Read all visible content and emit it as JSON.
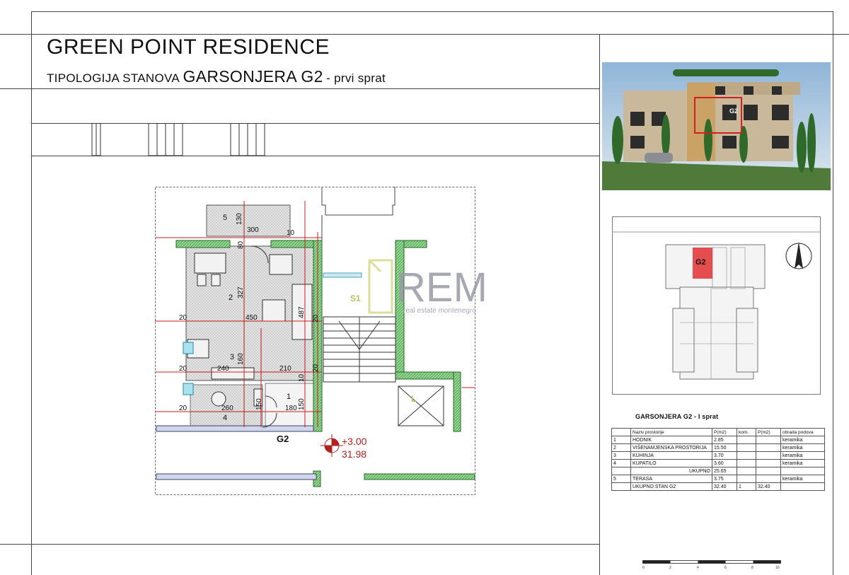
{
  "sheet": {
    "title": "GREEN POINT RESIDENCE",
    "subtitle_prefix": "TIPOLOGIJA STANOVA",
    "subtitle_unit": "GARSONJERA G2",
    "subtitle_suffix": "- prvi sprat"
  },
  "plan": {
    "unit_label": "G2",
    "elevation": "+3.00",
    "level_value": "31.98",
    "stair_label": "S1",
    "lift_label": "L",
    "rooms": [
      "5",
      "2",
      "3",
      "1",
      "4"
    ],
    "dimensions": [
      "300",
      "130",
      "10",
      "327",
      "450",
      "487",
      "20",
      "160",
      "240",
      "210",
      "10",
      "20",
      "260",
      "150",
      "180",
      "150",
      "20",
      "80",
      "20",
      "20"
    ]
  },
  "watermark": {
    "brand": "REM",
    "tagline": "real estate montenegro"
  },
  "photo": {
    "unit_tag": "G2"
  },
  "keyplan": {
    "unit_tag": "G2"
  },
  "table": {
    "title": "GARSONJERA G2 - I sprat",
    "headers": [
      "",
      "Naziv prostorije",
      "P(m2)",
      "kom.",
      "P(m2)",
      "obrada podova"
    ],
    "rows": [
      {
        "no": "1",
        "name": "HODNIK",
        "area": "2.85",
        "kom": "",
        "p": "",
        "floor": "keramika"
      },
      {
        "no": "2",
        "name": "VIŠENAMJENSKA PROSTORIJA",
        "area": "15.50",
        "kom": "",
        "p": "",
        "floor": "keramika"
      },
      {
        "no": "3",
        "name": "KUHINJA",
        "area": "3.70",
        "kom": "",
        "p": "",
        "floor": "keramika"
      },
      {
        "no": "4",
        "name": "KUPATILO",
        "area": "3.60",
        "kom": "",
        "p": "",
        "floor": "keramika"
      }
    ],
    "subtotal_label": "UKUPNO",
    "subtotal_value": "25.65",
    "terrace": {
      "no": "5",
      "name": "TERASA",
      "area": "3.75",
      "floor": "keramika"
    },
    "total": {
      "label": "UKUPNO STAN G2",
      "area": "32.40",
      "kom": "1",
      "p": "32.40"
    }
  },
  "scale": {
    "ticks": [
      "0",
      "2",
      "4",
      "6",
      "8",
      "10"
    ]
  },
  "colors": {
    "wall_green": "#8fd48f",
    "dimension_red": "#c82020",
    "highlight_red": "#e03030",
    "floor_hatch": "#d8d8d8",
    "window_cyan": "#6ecbe0"
  }
}
